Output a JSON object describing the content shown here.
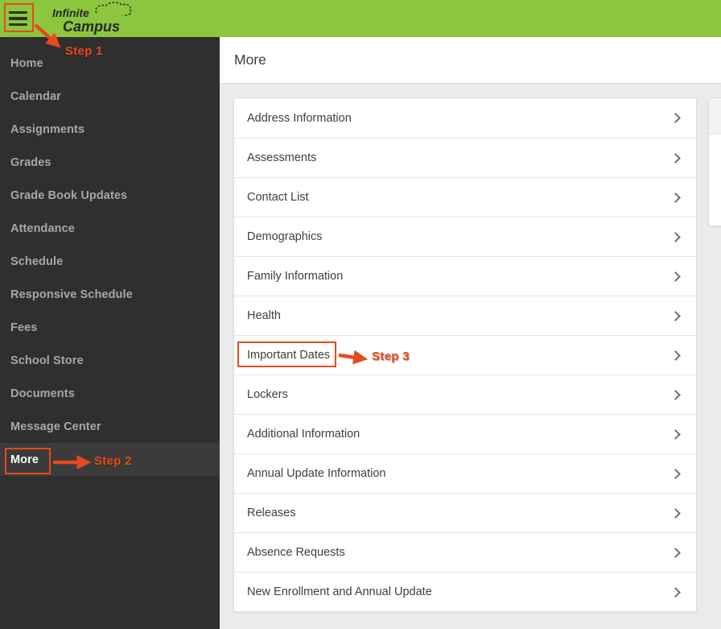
{
  "header": {
    "logo": {
      "line1": "Infinite",
      "line2": "Campus"
    }
  },
  "sidebar": {
    "items": [
      "Home",
      "Calendar",
      "Assignments",
      "Grades",
      "Grade Book Updates",
      "Attendance",
      "Schedule",
      "Responsive Schedule",
      "Fees",
      "School Store",
      "Documents",
      "Message Center",
      "More"
    ],
    "selected_item": "More"
  },
  "main": {
    "title": "More",
    "menu_items": [
      "Address Information",
      "Assessments",
      "Contact List",
      "Demographics",
      "Family Information",
      "Health",
      "Important Dates",
      "Lockers",
      "Additional Information",
      "Annual Update Information",
      "Releases",
      "Absence Requests",
      "New Enrollment and Annual Update"
    ]
  },
  "annotations": {
    "steps": [
      "Step 1",
      "Step 2",
      "Step 3"
    ],
    "highlighted_sidebar_item": "More",
    "highlighted_menu_item": "Important Dates",
    "color": "#e8491d"
  },
  "colors": {
    "header_green": "#8cc63e",
    "sidebar_bg": "#2f2f2f",
    "sidebar_selected_bg": "#3b3b3b",
    "content_bg": "#ebebeb",
    "annotation_orange": "#e8491d"
  }
}
